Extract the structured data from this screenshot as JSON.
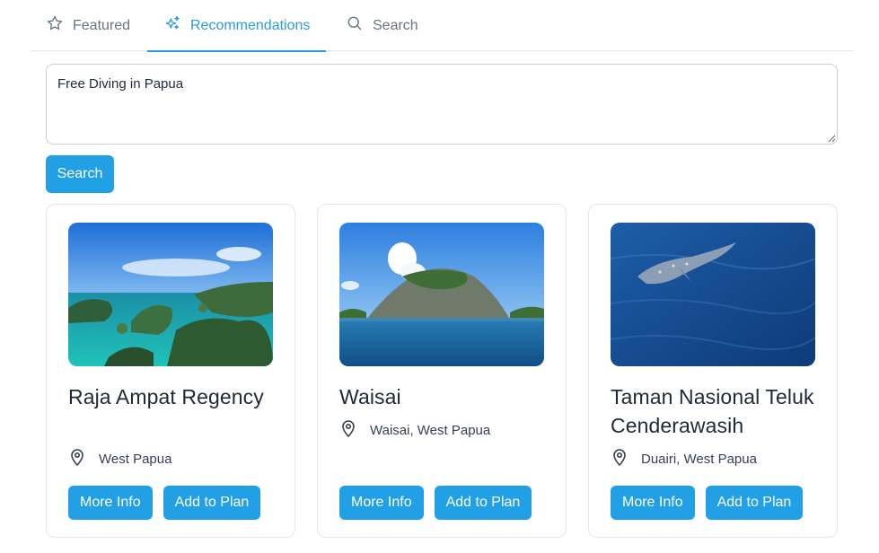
{
  "tabs": {
    "featured": {
      "label": "Featured",
      "icon": "star-icon"
    },
    "recommendations": {
      "label": "Recommendations",
      "icon": "sparkles-icon",
      "active": true
    },
    "search": {
      "label": "Search",
      "icon": "search-icon"
    }
  },
  "query": {
    "value": "Free Diving in Papua"
  },
  "search_button": {
    "label": "Search"
  },
  "colors": {
    "accent": "#22a0e6",
    "active_tab": "#2b9be0",
    "border": "#e3e6eb"
  },
  "cards": [
    {
      "title": "Raja Ampat Regency",
      "location": "West Papua",
      "more_info": "More Info",
      "add_to_plan": "Add to Plan"
    },
    {
      "title": "Waisai",
      "location": "Waisai, West Papua",
      "more_info": "More Info",
      "add_to_plan": "Add to Plan"
    },
    {
      "title": "Taman Nasional Teluk Cenderawasih",
      "location": "Duairi, West Papua",
      "more_info": "More Info",
      "add_to_plan": "Add to Plan"
    }
  ]
}
